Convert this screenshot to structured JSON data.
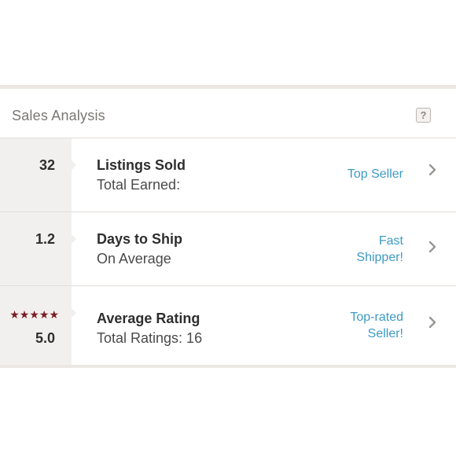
{
  "header": {
    "title": "Sales Analysis",
    "help_label": "?"
  },
  "rows": [
    {
      "stat": "32",
      "title": "Listings Sold",
      "subtitle": "Total Earned:",
      "badge": "Top Seller"
    },
    {
      "stat": "1.2",
      "title": "Days to Ship",
      "subtitle": "On Average",
      "badge_line1": "Fast",
      "badge_line2": "Shipper!"
    },
    {
      "stars": "★★★★★",
      "rating_stars": 5,
      "stat": "5.0",
      "title": "Average Rating",
      "subtitle": "Total Ratings: 16",
      "badge_line1": "Top-rated",
      "badge_line2": "Seller!"
    }
  ],
  "colors": {
    "accent_blue": "#3d9ac4",
    "star_red": "#7a1c24",
    "stat_bg": "#f2f0ee"
  },
  "icons": {
    "chevron": "chevron-right-icon",
    "help": "help-icon",
    "star": "star-icon"
  }
}
